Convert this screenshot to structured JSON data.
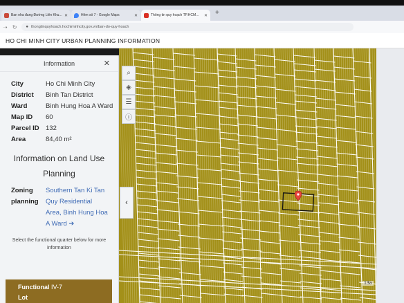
{
  "browser": {
    "tabs": [
      {
        "label": "Ban nha đang Đường Liên Khu...",
        "color": "#c94a3a",
        "active": false
      },
      {
        "label": "Hẻm số 7 - Google Maps",
        "color": "#3e82f7",
        "active": false
      },
      {
        "label": "Thông tin quy hoạch TP.HCM...",
        "color": "#d93025",
        "active": true
      }
    ],
    "new_tab": "+",
    "url": "thongtinquyhoach.hochiminhcity.gov.vn/ban-do-quy-hoach"
  },
  "site": {
    "title": "HO CHI MINH CITY URBAN PLANNING INFORMATION"
  },
  "panel": {
    "header": "Information",
    "close_icon": "close-icon",
    "rows": [
      {
        "key": "City",
        "value": "Ho Chi Minh City"
      },
      {
        "key": "District",
        "value": "Binh Tan District"
      },
      {
        "key": "Ward",
        "value": "Binh Hung Hoa A Ward"
      },
      {
        "key": "Map ID",
        "value": "60"
      },
      {
        "key": "Parcel ID",
        "value": "132"
      },
      {
        "key": "Area",
        "value": "84,40 m²"
      }
    ],
    "land_use_title": "Information on Land Use Planning",
    "zoning_label": "Zoning planning",
    "zoning_value": "Southern Tan Ki Tan Quy Residential Area, Binh Hung Hoa A Ward ➔",
    "hint": "Select the functional quarter below for more information",
    "functional_lot_label": "Functional Lot",
    "functional_lot_value": "IV-7"
  },
  "map": {
    "tools": [
      "search-icon",
      "layers-icon",
      "list-icon",
      "info-icon"
    ],
    "collapse_icon": "chevron-left-icon",
    "marker_icon": "location-pin-icon",
    "scale_label": "13a",
    "fill_color": "#a39019",
    "marker_color": "#e8453c"
  }
}
